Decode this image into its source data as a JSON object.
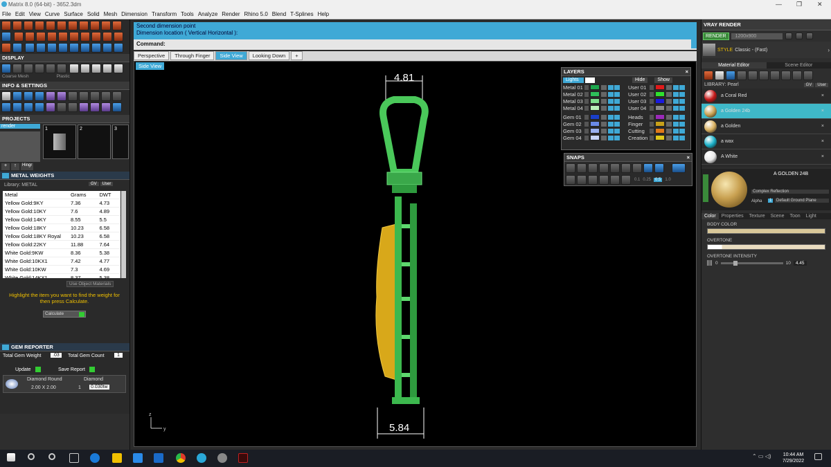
{
  "window": {
    "title": "Matrix 8.0 (64-bit) - 3652.3dm",
    "min": "—",
    "max": "❐",
    "close": "✕"
  },
  "menu": [
    "File",
    "Edit",
    "View",
    "Curve",
    "Surface",
    "Solid",
    "Mesh",
    "Dimension",
    "Transform",
    "Tools",
    "Analyze",
    "Render",
    "Rhino 5.0",
    "Blend",
    "T-Splines",
    "Help"
  ],
  "left": {
    "display_title": "DISPLAY",
    "display_modes": [
      "Coarse Mesh",
      "Plastic"
    ],
    "info_title": "INFO & SETTINGS",
    "projects_title": "PROJECTS",
    "project_name": "render",
    "project_slots": [
      "1",
      "2",
      "3"
    ],
    "hinge_btn": "Hingr",
    "metal_title": "METAL WEIGHTS",
    "library_label": "Library: METAL",
    "library_btns": {
      "gv": "GV",
      "user": "User"
    },
    "columns": [
      "Metal",
      "Grams",
      "DWT"
    ],
    "rows": [
      [
        "Yellow Gold:9KY",
        "7.36",
        "4.73"
      ],
      [
        "Yellow Gold:10KY",
        "7.6",
        "4.89"
      ],
      [
        "Yellow Gold:14KY",
        "8.55",
        "5.5"
      ],
      [
        "Yellow Gold:18KY",
        "10.23",
        "6.58"
      ],
      [
        "Yellow Gold:18KY Royal",
        "10.23",
        "6.58"
      ],
      [
        "Yellow Gold:22KY",
        "11.88",
        "7.64"
      ],
      [
        "White Gold:9KW",
        "8.36",
        "5.38"
      ],
      [
        "White Gold:10KX1",
        "7.42",
        "4.77"
      ],
      [
        "White Gold:10KW",
        "7.3",
        "4.69"
      ],
      [
        "White Gold:14KX1",
        "8.37",
        "5.38"
      ],
      [
        "White Gold:14K PdW",
        "9.56",
        "6.15"
      ]
    ],
    "use_object_materials": "Use Object Materials",
    "hint": "Highlight the item you want to find the weight for then press Calculate.",
    "calculate": "Calculate",
    "gem_title": "GEM REPORTER",
    "total_gem_weight_label": "Total Gem Weight",
    "total_gem_weight": ".03",
    "total_gem_count_label": "Total Gem Count",
    "total_gem_count": "1",
    "update": "Update",
    "save_report": "Save Report",
    "gem_cols": [
      "Diamond Round",
      "Diamond"
    ],
    "gem_row": [
      "2.00 X 2.00",
      "1",
      "0.030tw"
    ]
  },
  "command": {
    "log": [
      "Second dimension point",
      "Dimension location ( Vertical  Horizontal ):"
    ],
    "prompt": "Command:"
  },
  "viewport_tabs": [
    "Perspective",
    "Through Finger",
    "Side View",
    "Looking Down",
    "+"
  ],
  "active_tab": "Side View",
  "viewport_label": "Side View",
  "dims": {
    "top": "4.81",
    "bottom": "5.84"
  },
  "axis": {
    "z": "z",
    "y": "y"
  },
  "layers": {
    "title": "LAYERS",
    "lights": "Lights",
    "hide": "Hide",
    "show": "Show",
    "left": [
      {
        "name": "Metal 01",
        "color": "#1ea84e"
      },
      {
        "name": "Metal 02",
        "color": "#2ec05a"
      },
      {
        "name": "Metal 03",
        "color": "#7ee08e"
      },
      {
        "name": "Metal 04",
        "color": "#b8f0b8"
      },
      {
        "name": "Gem 01",
        "color": "#1a3fc8"
      },
      {
        "name": "Gem 02",
        "color": "#6a8ae8"
      },
      {
        "name": "Gem 03",
        "color": "#9ab0f0"
      },
      {
        "name": "Gem 04",
        "color": "#c8d4f8"
      }
    ],
    "right": [
      {
        "name": "User 01",
        "color": "#e01a1a"
      },
      {
        "name": "User 02",
        "color": "#2ee02e"
      },
      {
        "name": "User 03",
        "color": "#1a1ae0"
      },
      {
        "name": "User 04",
        "color": "#888888"
      },
      {
        "name": "Heads",
        "color": "#9a2ab8"
      },
      {
        "name": "Finger",
        "color": "#c8a01a"
      },
      {
        "name": "Cutting",
        "color": "#e07a1a"
      },
      {
        "name": "Creation",
        "color": "#e0c81a"
      }
    ]
  },
  "snaps": {
    "title": "SNAPS",
    "values": [
      "0.1",
      "0.25",
      "0.5",
      "1.0"
    ]
  },
  "vray": {
    "title": "VRAY RENDER",
    "render_btn": "RENDER",
    "resolution": "1200x900",
    "style_label": "STYLE",
    "style_value": "Classic - (Fast)",
    "tabs": [
      "Material Editor",
      "Scene Editor"
    ],
    "library": "LIBRARY: Pearl",
    "lib_btns": {
      "gv": "GV",
      "user": "User"
    },
    "materials": [
      {
        "name": "a Coral Red",
        "color": "#c81a1a",
        "selected": false
      },
      {
        "name": "a Golden 24b",
        "color": "#c8a050",
        "selected": true
      },
      {
        "name": "a Golden",
        "color": "#d8b060",
        "selected": false
      },
      {
        "name": "a wax",
        "color": "#1ab0c8",
        "selected": false
      },
      {
        "name": "A White",
        "color": "#e8e8e8",
        "selected": false
      }
    ],
    "preview_name": "A GOLDEN 24B",
    "reflection": "Complex Reflection",
    "alpha_label": "Alpha",
    "alpha_value": "1",
    "ground": "Default Ground Plane",
    "prop_tabs": [
      "Color",
      "Properties",
      "Texture",
      "Scene",
      "Toon",
      "Light"
    ],
    "body_color": "BODY COLOR",
    "overtone": "OVERTONE",
    "overtone_intensity": "OVERTONE INTENSITY",
    "intensity_min": "0",
    "intensity_max": "10",
    "intensity_value": "4.45",
    "accent": "#3fa9d6",
    "selected_row": "#3fb8c8"
  },
  "taskbar": {
    "time": "10:44 AM",
    "date": "7/29/2022"
  }
}
